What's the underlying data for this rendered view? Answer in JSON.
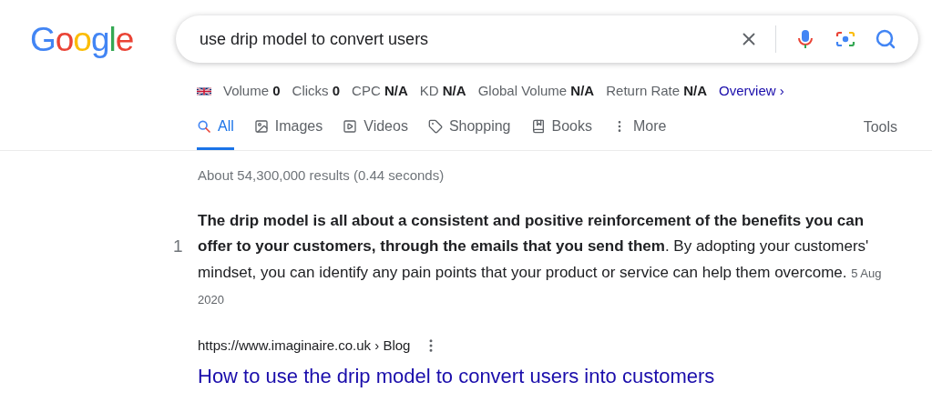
{
  "logo": "Google",
  "search": {
    "value": "use drip model to convert users"
  },
  "metrics": [
    {
      "label": "Volume",
      "value": "0"
    },
    {
      "label": "Clicks",
      "value": "0"
    },
    {
      "label": "CPC",
      "value": "N/A"
    },
    {
      "label": "KD",
      "value": "N/A"
    },
    {
      "label": "Global Volume",
      "value": "N/A"
    },
    {
      "label": "Return Rate",
      "value": "N/A"
    }
  ],
  "overview_link": "Overview ›",
  "tabs": [
    {
      "label": "All",
      "kind": "all",
      "selected": true
    },
    {
      "label": "Images",
      "kind": "images",
      "selected": false
    },
    {
      "label": "Videos",
      "kind": "videos",
      "selected": false
    },
    {
      "label": "Shopping",
      "kind": "shopping",
      "selected": false
    },
    {
      "label": "Books",
      "kind": "books",
      "selected": false
    },
    {
      "label": "More",
      "kind": "more",
      "selected": false
    }
  ],
  "tools": "Tools",
  "result_stats": "About 54,300,000 results (0.44 seconds)",
  "featured_snippet": {
    "marker": "1",
    "text": "**The drip model is all about a consistent and positive reinforcement of the benefits you can offer to your customers, through the emails that you send them**. By adopting your customers' mindset, you can identify any pain points that your product or service can help them overcome.",
    "date": "5 Aug 2020"
  },
  "result": {
    "url": "https://www.imaginaire.co.uk › Blog",
    "title": "How to use the drip model to convert users into customers"
  }
}
